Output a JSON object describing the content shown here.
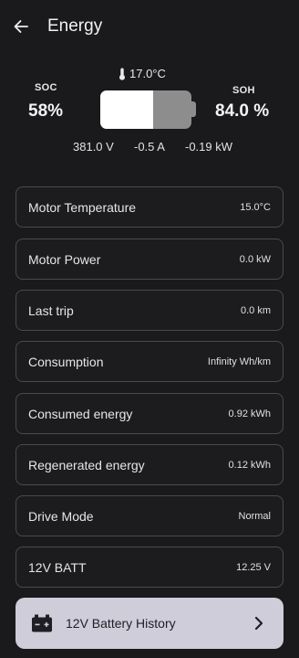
{
  "header": {
    "title": "Energy",
    "back_icon": "arrow-left-icon"
  },
  "battery": {
    "soc_label": "SOC",
    "soc_value": "58%",
    "soc_fraction": 0.58,
    "soh_label": "SOH",
    "soh_value": "84.0 %",
    "temperature": "17.0°C",
    "voltage": "381.0 V",
    "current": "-0.5 A",
    "power": "-0.19 kW",
    "colors": {
      "fill": "#ffffff",
      "empty": "#8d8d8d"
    }
  },
  "stats": [
    {
      "label": "Motor Temperature",
      "value": "15.0°C"
    },
    {
      "label": "Motor Power",
      "value": "0.0 kW"
    },
    {
      "label": "Last trip",
      "value": "0.0 km"
    },
    {
      "label": "Consumption",
      "value": "Infinity Wh/km"
    },
    {
      "label": "Consumed energy",
      "value": "0.92 kWh"
    },
    {
      "label": "Regenerated energy",
      "value": "0.12 kWh"
    },
    {
      "label": "Drive Mode",
      "value": "Normal"
    },
    {
      "label": "12V BATT",
      "value": "12.25 V"
    }
  ],
  "history_button": {
    "label": "12V Battery History",
    "icon": "car-battery-icon",
    "chevron": "chevron-right-icon",
    "color": "#cfcdd9"
  }
}
